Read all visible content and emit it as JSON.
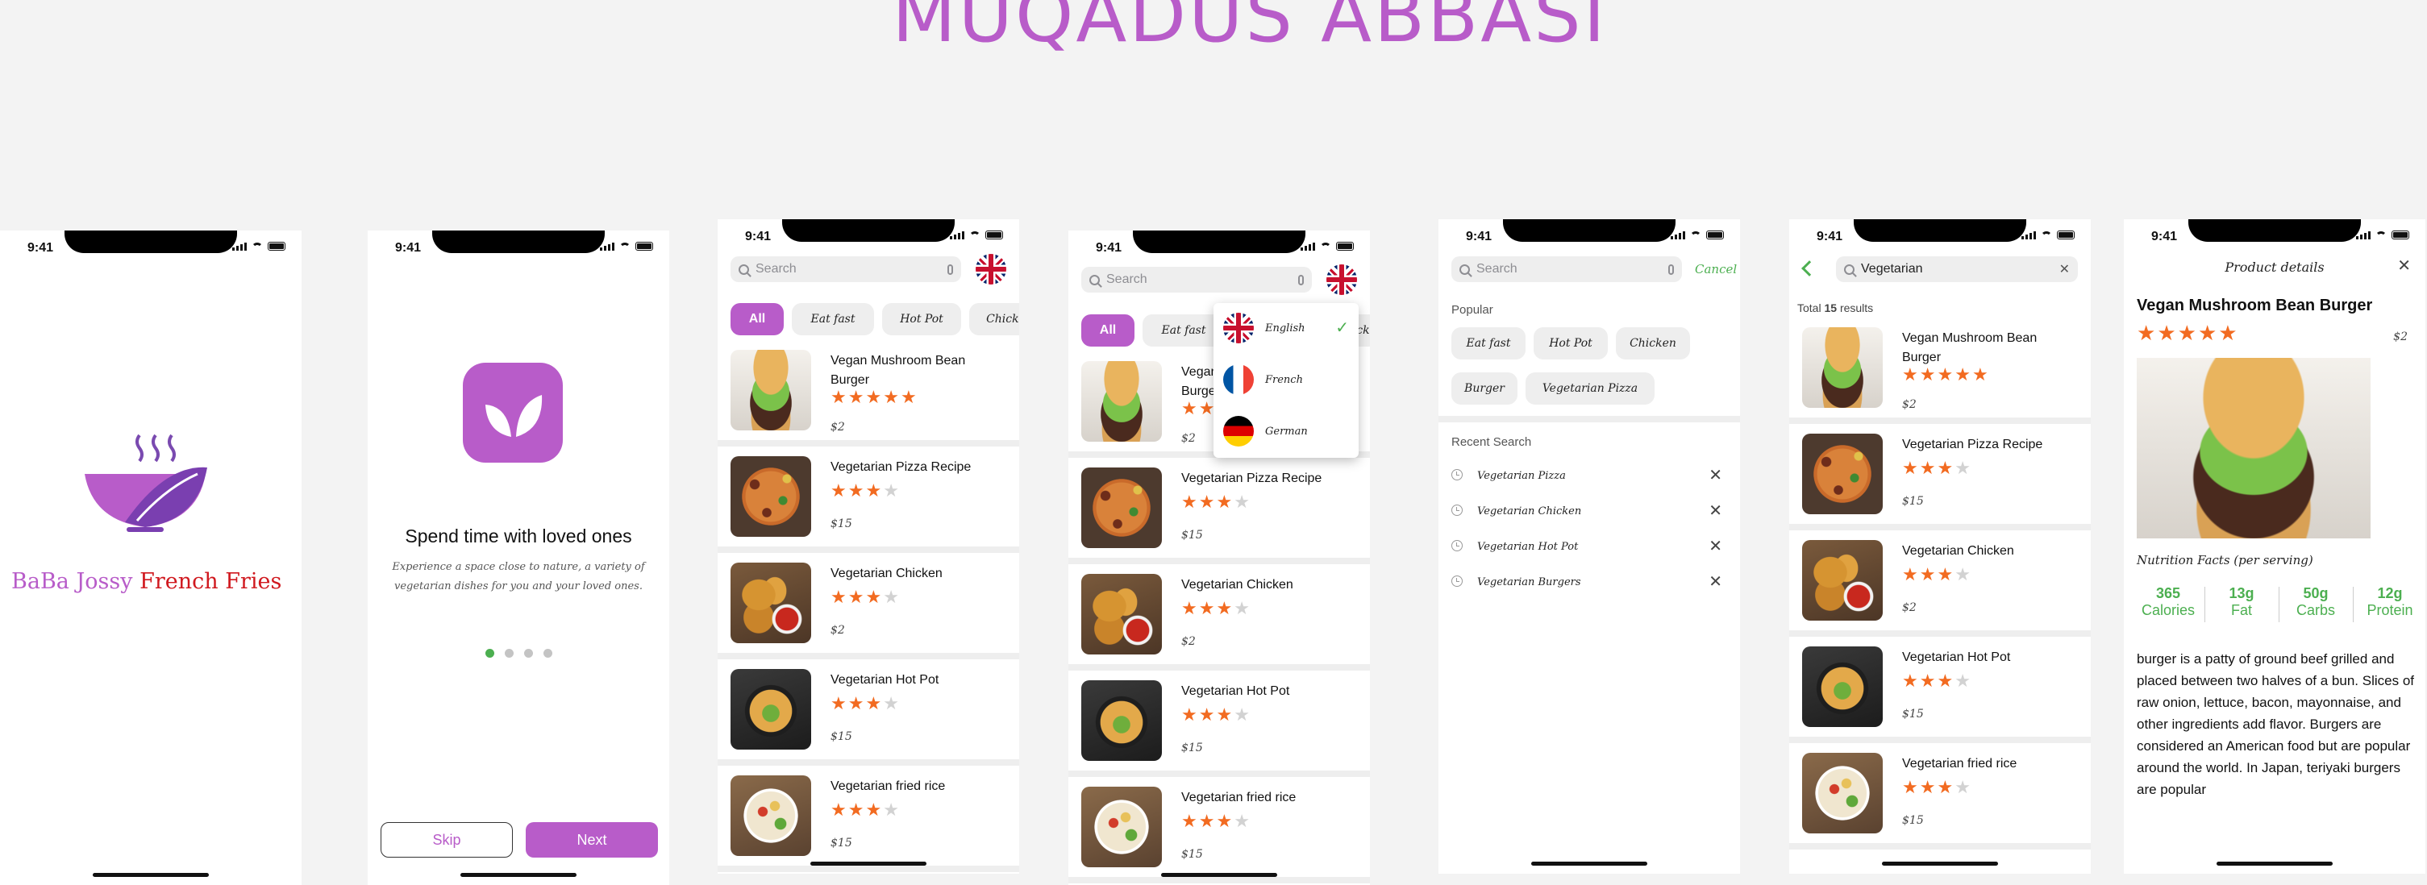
{
  "designer_name": "MUQADUS ABBASI",
  "status_time": "9:41",
  "splash": {
    "brand_part1": "BaBa Jossy",
    "brand_part2": "French Fries",
    "accent": "#b85cc9",
    "brand_red": "#d0181e"
  },
  "onboarding": {
    "title": "Spend time with loved ones",
    "subtitle_line1": "Experience a space close to nature, a variety of",
    "subtitle_line2": "vegetarian dishes for you and your loved ones.",
    "skip_label": "Skip",
    "next_label": "Next",
    "active_page": 1,
    "total_pages": 4
  },
  "search": {
    "placeholder": "Search",
    "cancel_label": "Cancel",
    "query": "Vegetarian"
  },
  "categories": [
    "All",
    "Eat fast",
    "Hot Pot",
    "Chicken"
  ],
  "foods": [
    {
      "name": "Vegan Mushroom Bean Burger",
      "rating": 5,
      "price": "$2",
      "image": "burger"
    },
    {
      "name": "Vegetarian Pizza Recipe",
      "rating": 3,
      "price": "$15",
      "image": "pizza"
    },
    {
      "name": "Vegetarian Chicken",
      "rating": 3,
      "price": "$2",
      "image": "chicken"
    },
    {
      "name": "Vegetarian Hot Pot",
      "rating": 3,
      "price": "$15",
      "image": "hotpot"
    },
    {
      "name": "Vegetarian fried rice",
      "rating": 3,
      "price": "$15",
      "image": "rice"
    }
  ],
  "languages": [
    {
      "label": "English",
      "flag": "uk-flag",
      "selected": true
    },
    {
      "label": "French",
      "flag": "france-flag",
      "selected": false
    },
    {
      "label": "German",
      "flag": "germany-flag",
      "selected": false
    }
  ],
  "search_screen": {
    "popular_heading": "Popular",
    "popular": [
      "Eat fast",
      "Hot Pot",
      "Chicken",
      "Burger",
      "Vegetarian Pizza"
    ],
    "recent_heading": "Recent Search",
    "recent": [
      "Vegetarian Pizza",
      "Vegetarian Chicken",
      "Vegetarian Hot Pot",
      "Vegetarian Burgers"
    ]
  },
  "results": {
    "total_prefix": "Total",
    "total_count": "15",
    "total_suffix": "results"
  },
  "product": {
    "header": "Product details",
    "name": "Vegan Mushroom Bean Burger",
    "rating": 5,
    "price": "$2",
    "nutrition_heading": "Nutrition Facts (per serving)",
    "nutrition": [
      {
        "value": "365",
        "label": "Calories"
      },
      {
        "value": "13g",
        "label": "Fat"
      },
      {
        "value": "50g",
        "label": "Carbs"
      },
      {
        "value": "12g",
        "label": "Protein"
      }
    ],
    "description": "burger is a patty of ground beef grilled and placed between two halves of a bun. Slices of raw onion, lettuce, bacon, mayonnaise, and other ingredients add flavor. Burgers are considered an American food but are popular around the world. In Japan, teriyaki burgers are popular"
  },
  "colors": {
    "accent": "#b85cc9",
    "star": "#f26b21",
    "green": "#4caf50"
  },
  "icons": [
    "signal-icon",
    "wifi-icon",
    "battery-icon",
    "search-icon",
    "mic-icon",
    "back-icon",
    "close-icon",
    "clock-icon",
    "check-icon",
    "leaf-logo-icon",
    "bowl-logo-icon"
  ]
}
